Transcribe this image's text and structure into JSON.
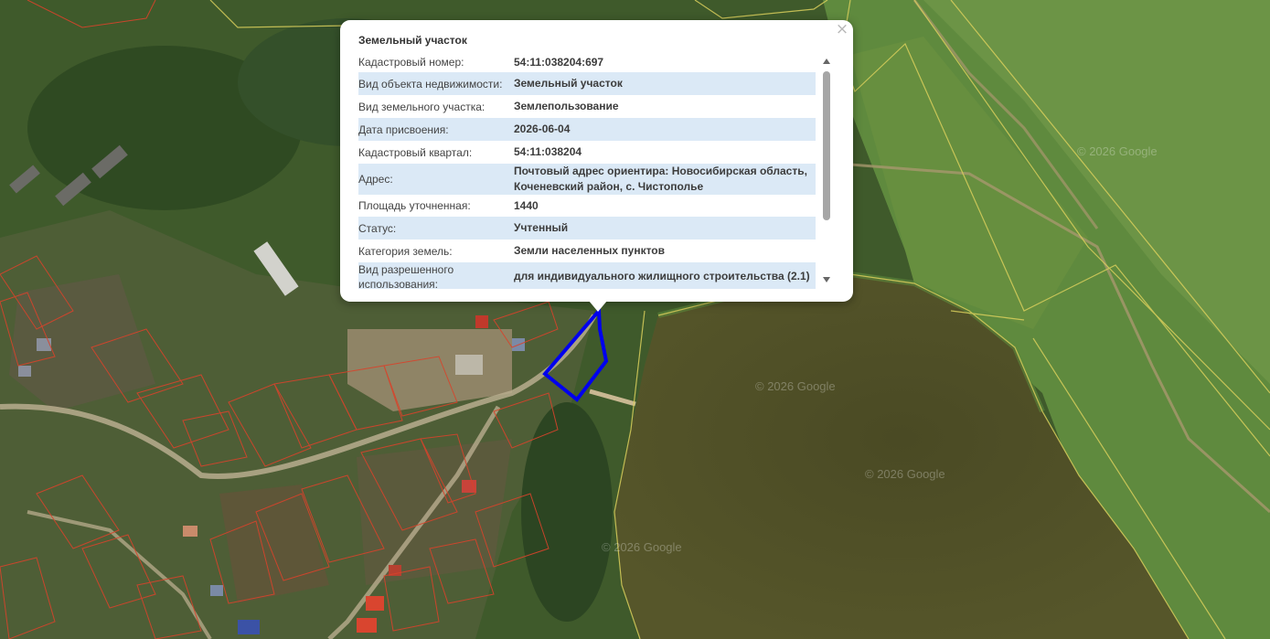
{
  "map": {
    "watermarks": [
      "© 2026 Google",
      "© 2026 Google",
      "© 2026 Google",
      "© 2026 Google"
    ],
    "selected_parcel_color": "#0000ee",
    "parcel_line_color": "#d8432b",
    "boundary_line_color": "#d9cf5c"
  },
  "popup": {
    "title": "Земельный участок",
    "close_glyph": "×",
    "rows": [
      {
        "label": "Кадастровый номер:",
        "value": "54:11:038204:697"
      },
      {
        "label": "Вид объекта недвижимости:",
        "value": "Земельный участок"
      },
      {
        "label": "Вид земельного участка:",
        "value": "Землепользование"
      },
      {
        "label": "Дата присвоения:",
        "value": "2026-06-04"
      },
      {
        "label": "Кадастровый квартал:",
        "value": "54:11:038204"
      },
      {
        "label": "Адрес:",
        "value": "Почтовый адрес ориентира: Новосибирская область, Коченевский район, с. Чистополье"
      },
      {
        "label": "Площадь уточненная:",
        "value": "1440"
      },
      {
        "label": "Статус:",
        "value": "Учтенный"
      },
      {
        "label": "Категория земель:",
        "value": "Земли населенных пунктов"
      },
      {
        "label": "Вид разрешенного использования:",
        "value": "для индивидуального жилищного строительства (2.1)"
      }
    ]
  }
}
